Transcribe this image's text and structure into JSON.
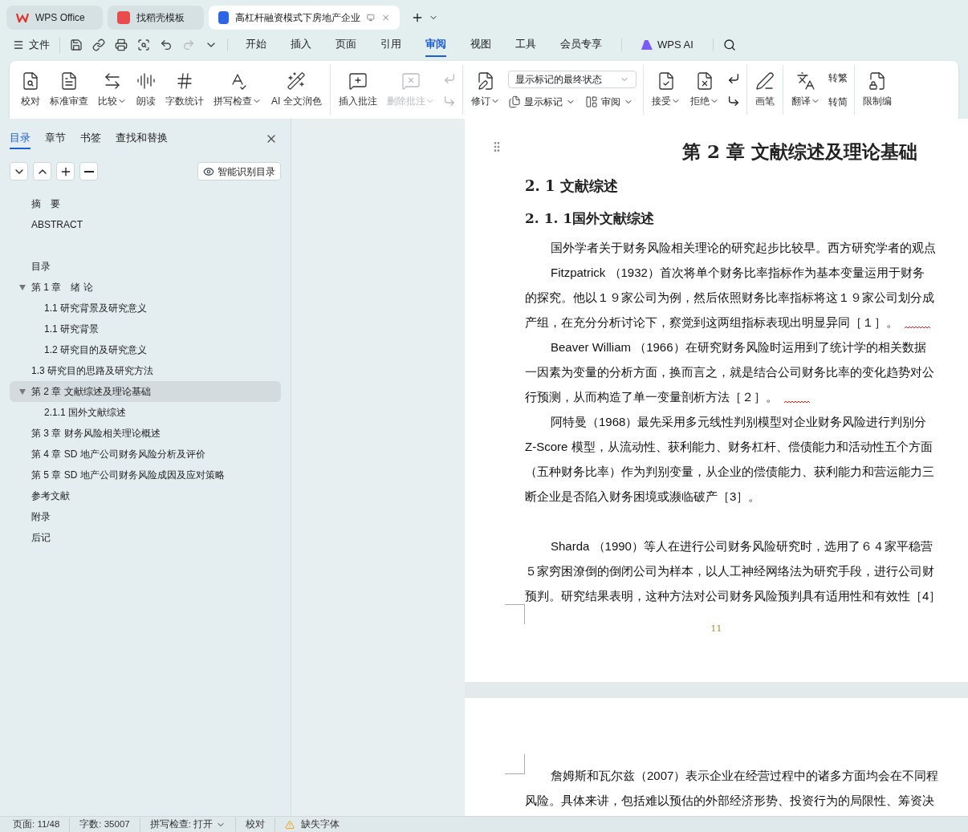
{
  "app_tabs": [
    {
      "label": "WPS Office",
      "selected": false
    },
    {
      "label": "找稻壳模板",
      "selected": false
    },
    {
      "label": "高杠杆融资模式下房地产企业",
      "selected": true
    }
  ],
  "menu": {
    "file": "文件",
    "tabs": [
      {
        "label": "开始",
        "selected": false
      },
      {
        "label": "插入",
        "selected": false
      },
      {
        "label": "页面",
        "selected": false
      },
      {
        "label": "引用",
        "selected": false
      },
      {
        "label": "审阅",
        "selected": true
      },
      {
        "label": "视图",
        "selected": false
      },
      {
        "label": "工具",
        "selected": false
      },
      {
        "label": "会员专享",
        "selected": false
      }
    ],
    "ai": "WPS AI"
  },
  "ribbon": {
    "proof": [
      {
        "label": "校对",
        "dropdown": false,
        "disabled": false
      },
      {
        "label": "标准审查",
        "dropdown": false,
        "disabled": false
      },
      {
        "label": "比较",
        "dropdown": true,
        "disabled": false
      },
      {
        "label": "朗读",
        "dropdown": false,
        "disabled": false
      },
      {
        "label": "字数统计",
        "dropdown": false,
        "disabled": false
      },
      {
        "label": "拼写检查",
        "dropdown": true,
        "disabled": false
      },
      {
        "label": "AI 全文润色",
        "dropdown": false,
        "disabled": false
      }
    ],
    "comments": [
      {
        "label": "插入批注",
        "dropdown": false,
        "disabled": false
      },
      {
        "label": "删除批注",
        "dropdown": true,
        "disabled": true
      }
    ],
    "comment_nav": [
      {
        "disabled": true
      },
      {
        "disabled": true
      }
    ],
    "track": {
      "label": "修订",
      "dropdown": true
    },
    "markup_select": {
      "value": "显示标记的最终状态"
    },
    "markup_small": [
      {
        "label": "显示标记",
        "dropdown": true
      },
      {
        "label": "审阅",
        "dropdown": true
      }
    ],
    "changes": [
      {
        "label": "接受",
        "dropdown": true
      },
      {
        "label": "拒绝",
        "dropdown": true
      }
    ],
    "pen": "画笔",
    "translate": {
      "label": "翻译",
      "dropdown": true
    },
    "convert": [
      "转繁",
      "转简"
    ],
    "restrict": "限制编"
  },
  "sidebar": {
    "tabs": [
      {
        "label": "目录",
        "selected": true
      },
      {
        "label": "章节",
        "selected": false
      },
      {
        "label": "书签",
        "selected": false
      },
      {
        "label": "查找和替换",
        "selected": false
      }
    ],
    "smart_button": "智能识别目录",
    "toc": [
      {
        "label": "摘　要",
        "selected": false
      },
      {
        "label": "ABSTRACT",
        "selected": false
      },
      {
        "label": "目录",
        "selected": false
      },
      {
        "label": "第 1 章　绪 论",
        "selected": false,
        "expanded": true,
        "children": [
          {
            "label": "1.1  研究背景及研究意义",
            "selected": false
          },
          {
            "label": "1.1 研究背景",
            "selected": false
          },
          {
            "label": "1.2 研究目的及研究意义",
            "selected": false
          }
        ]
      },
      {
        "label": "1.3 研究目的思路及研究方法",
        "selected": false
      },
      {
        "label": "第 2 章  文献综述及理论基础",
        "selected": true,
        "expanded": true,
        "children": [
          {
            "label": "2.1.1 国外文献综述",
            "selected": false
          }
        ]
      },
      {
        "label": "第 3 章  财务风险相关理论概述",
        "selected": false
      },
      {
        "label": "第 4 章 SD 地产公司财务风险分析及评价",
        "selected": false
      },
      {
        "label": "第 5 章 SD 地产公司财务风险成因及应对策略",
        "selected": false
      },
      {
        "label": "参考文献",
        "selected": false
      },
      {
        "label": "附录",
        "selected": false
      },
      {
        "label": "后记",
        "selected": false
      }
    ]
  },
  "document": {
    "pages": [
      {
        "blocks": [
          {
            "kind": "chapter",
            "text": "第 2 章  文献综述及理论基础"
          },
          {
            "kind": "section",
            "text": "2. 1 文献综述"
          },
          {
            "kind": "subsection",
            "text": "2. 1. 1国外文献综述"
          },
          {
            "kind": "paragraph",
            "flagged": false,
            "lines": [
              "国外学者关于财务风险相关理论的研究起步比较早。西方研究学者的观点"
            ]
          },
          {
            "kind": "paragraph",
            "flagged": true,
            "lines": [
              "Fitzpatrick  （1932）首次将单个财务比率指标作为基本变量运用于财务",
              "的探究。他以１９家公司为例，然后依照财务比率指标将这１９家公司划分成",
              "产组，在充分分析讨论下，察觉到这两组指标表现出明显异同［１］。"
            ]
          },
          {
            "kind": "paragraph",
            "flagged": true,
            "lines": [
              "Beaver  William  （1966）在研究财务风险时运用到了统计学的相关数据",
              "一因素为变量的分析方面，换而言之，就是结合公司财务比率的变化趋势对公",
              "行预测，从而构造了单一变量剖析方法［２］。"
            ]
          },
          {
            "kind": "paragraph",
            "flagged": false,
            "lines": [
              "阿特曼（1968）最先采用多元线性判别模型对企业财务风险进行判别分",
              "Z-Score 模型，从流动性、获利能力、财务杠杆、偿债能力和活动性五个方面",
              "（五种财务比率）作为判别变量，从企业的偿债能力、获利能力和营运能力三",
              "断企业是否陷入财务困境或濒临破产［3］。"
            ]
          },
          {
            "kind": "blank"
          },
          {
            "kind": "paragraph",
            "flagged": false,
            "lines": [
              "Sharda  （1990）等人在进行公司财务风险研究时，选用了６４家平稳营",
              "５家穷困潦倒的倒闭公司为样本，以人工神经网络法为研究手段，进行公司财",
              "预判。研究结果表明，这种方法对公司财务风险预判具有适用性和有效性［4］"
            ]
          }
        ],
        "page_number": "11"
      },
      {
        "blocks": [
          {
            "kind": "paragraph",
            "flagged": false,
            "lines": [
              "詹姆斯和瓦尔兹（2007）表示企业在经营过程中的诸多方面均会在不同程",
              "风险。具体来讲，包括难以预估的外部经济形势、投资行为的局限性、筹资决"
            ]
          }
        ]
      }
    ]
  },
  "status_bar": {
    "page": "页面: 11/48",
    "words": "字数: 35007",
    "spell": "拼写检查: 打开",
    "proof": "校对",
    "fonts": "缺失字体"
  }
}
